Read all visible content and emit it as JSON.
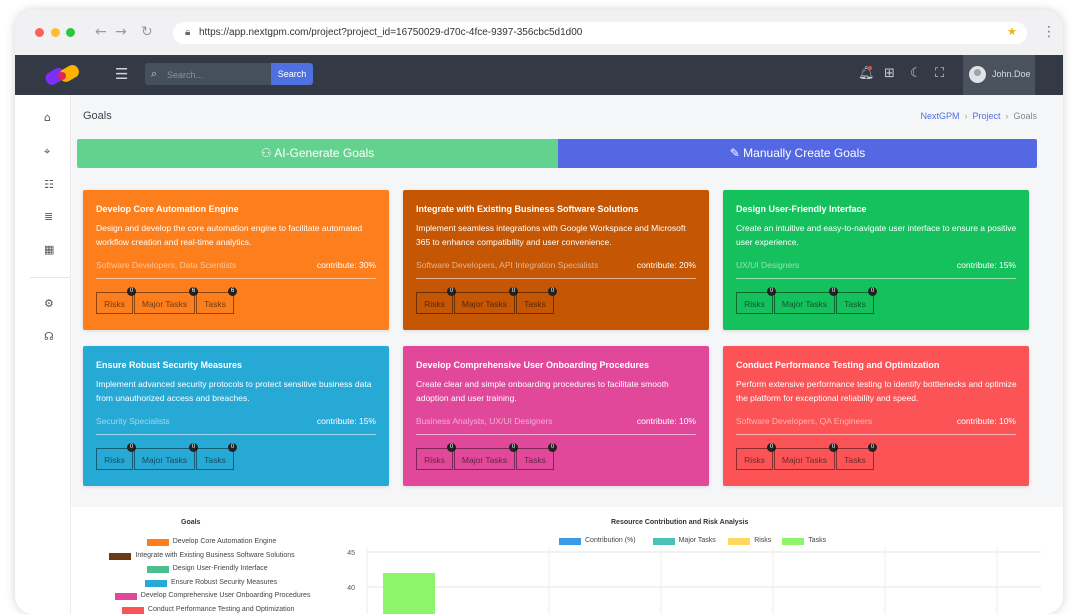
{
  "browser": {
    "url": "https://app.nextgpm.com/project?project_id=16750029-d70c-4fce-9397-356cbc5d1d00"
  },
  "header": {
    "search_placeholder": "Search...",
    "search_button": "Search",
    "user_name": "John.Doe"
  },
  "page": {
    "title": "Goals",
    "breadcrumbs": [
      "NextGPM",
      "Project",
      "Goals"
    ]
  },
  "actions": {
    "ai_generate": "AI-Generate Goals",
    "manual_create": "Manually Create Goals"
  },
  "goals": [
    {
      "title": "Develop Core Automation Engine",
      "description": "Design and develop the core automation engine to facilitate automated workflow creation and real-time analytics.",
      "team": "Software Developers, Data Scientists",
      "contribute": "contribute: 30%",
      "color": "#fc7e1c",
      "risks": "0",
      "major_tasks": "6",
      "tasks": "6"
    },
    {
      "title": "Integrate with Existing Business Software Solutions",
      "description": "Implement seamless integrations with Google Workspace and Microsoft 365 to enhance compatibility and user convenience.",
      "team": "Software Developers, API Integration Specialists",
      "contribute": "contribute: 20%",
      "color": "#c45604",
      "risks": "0",
      "major_tasks": "0",
      "tasks": "0"
    },
    {
      "title": "Design User-Friendly Interface",
      "description": "Create an intuitive and easy-to-navigate user interface to ensure a positive user experience.",
      "team": "UX/UI Designers",
      "contribute": "contribute: 15%",
      "color": "#15c15c",
      "risks": "0",
      "major_tasks": "0",
      "tasks": "0"
    },
    {
      "title": "Ensure Robust Security Measures",
      "description": "Implement advanced security protocols to protect sensitive business data from unauthorized access and breaches.",
      "team": "Security Specialists",
      "contribute": "contribute: 15%",
      "color": "#27a9d6",
      "risks": "0",
      "major_tasks": "0",
      "tasks": "0"
    },
    {
      "title": "Develop Comprehensive User Onboarding Procedures",
      "description": "Create clear and simple onboarding procedures to facilitate smooth adoption and user training.",
      "team": "Business Analysts, UX/UI Designers",
      "contribute": "contribute: 10%",
      "color": "#e2489a",
      "risks": "0",
      "major_tasks": "0",
      "tasks": "0"
    },
    {
      "title": "Conduct Performance Testing and Optimization",
      "description": "Perform extensive performance testing to identify bottlenecks and optimize the platform for exceptional reliability and speed.",
      "team": "Software Developers, QA Engineers",
      "contribute": "contribute: 10%",
      "color": "#fb5356",
      "risks": "0",
      "major_tasks": "0",
      "tasks": "0"
    }
  ],
  "pill_labels": {
    "risks": "Risks",
    "major_tasks": "Major Tasks",
    "tasks": "Tasks"
  },
  "chart_data": [
    {
      "type": "bar",
      "title": "Goals",
      "legend": [
        {
          "label": "Develop Core Automation Engine",
          "color": "#fc7e1c"
        },
        {
          "label": "Integrate with Existing Business Software Solutions",
          "color": "#6b3a12"
        },
        {
          "label": "Design User-Friendly Interface",
          "color": "#4dbf8f"
        },
        {
          "label": "Ensure Robust Security Measures",
          "color": "#27a9d6"
        },
        {
          "label": "Develop Comprehensive User Onboarding Procedures",
          "color": "#e2489a"
        },
        {
          "label": "Conduct Performance Testing and Optimization",
          "color": "#fb5356"
        }
      ]
    },
    {
      "type": "bar",
      "title": "Resource Contribution and Risk Analysis",
      "series": [
        {
          "name": "Contribution (%)",
          "color": "#3c9be6"
        },
        {
          "name": "Major Tasks",
          "color": "#49c2b7"
        },
        {
          "name": "Risks",
          "color": "#ffd75e"
        },
        {
          "name": "Tasks",
          "color": "#8ef56a"
        }
      ],
      "y_ticks": [
        "45",
        "40"
      ],
      "visible_bar": {
        "series": "Tasks",
        "value": 42
      }
    }
  ],
  "icons": {
    "sidebar": [
      "home-icon",
      "target-icon",
      "checklist-icon",
      "list-icon",
      "calculator-icon",
      "settings-icon",
      "headset-icon"
    ],
    "header": [
      "bell-icon",
      "apps-icon",
      "moon-icon",
      "fullscreen-icon"
    ]
  }
}
